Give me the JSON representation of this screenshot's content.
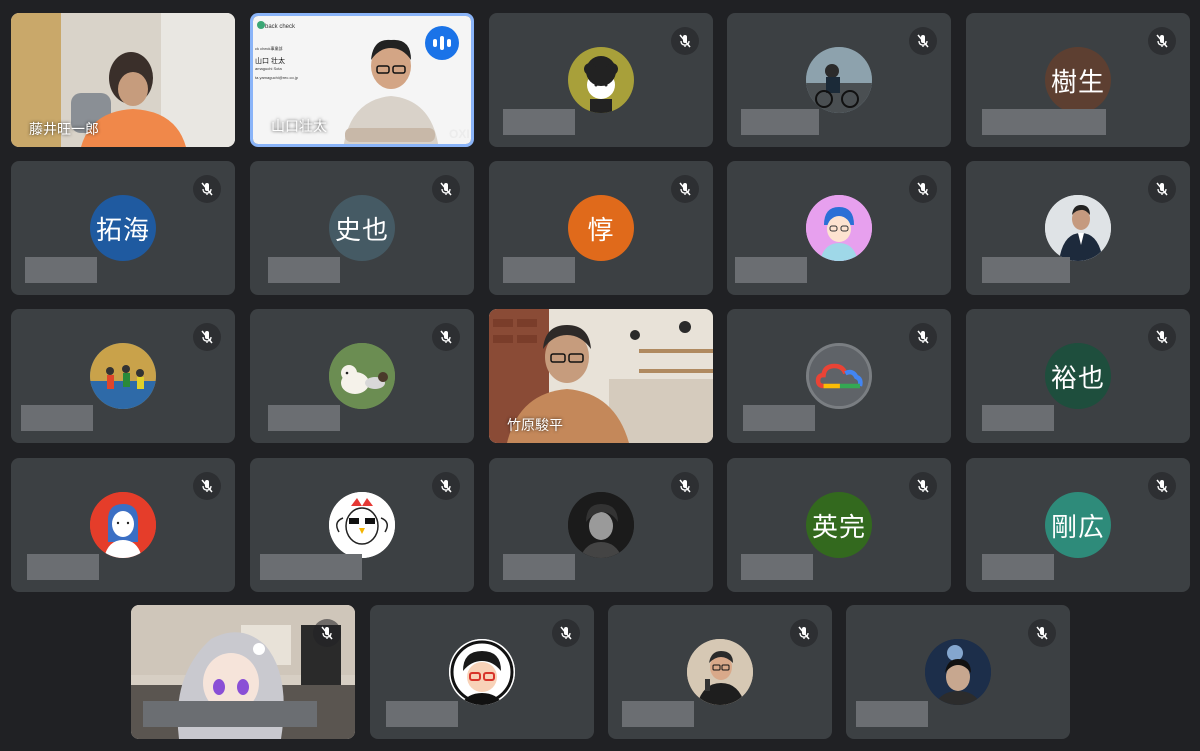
{
  "tiles": [
    {
      "id": "t1",
      "type": "video",
      "name": "藤井旺一郎"
    },
    {
      "id": "t2",
      "type": "video",
      "name": "山口壮太",
      "active": true,
      "slide": {
        "app": "back check",
        "line1": "ck check事業部",
        "line2": "山口 壮太",
        "line3": "amaguchi Sota",
        "line4": "ta.yamaguchi@rec.co.jp",
        "logo": "backcheck",
        "watermark": "OXI"
      }
    },
    {
      "id": "t3",
      "type": "avatar",
      "muted": true,
      "avatar_icon": "curly-hair-illustration-avatar",
      "avatar_color": "#a8a03a"
    },
    {
      "id": "t4",
      "type": "avatar",
      "muted": true,
      "avatar_icon": "cyclist-photo-avatar",
      "avatar_color": "#5b6e7a"
    },
    {
      "id": "t5",
      "type": "initials",
      "muted": true,
      "initials": "樹生",
      "avatar_color": "#5d3f31"
    },
    {
      "id": "t6",
      "type": "initials",
      "muted": true,
      "initials": "拓海",
      "avatar_color": "#1f5aa0"
    },
    {
      "id": "t7",
      "type": "initials",
      "muted": true,
      "initials": "史也",
      "avatar_color": "#455a64"
    },
    {
      "id": "t8",
      "type": "initials",
      "muted": true,
      "initials": "惇",
      "avatar_color": "#e06a1b"
    },
    {
      "id": "t9",
      "type": "avatar",
      "muted": true,
      "avatar_icon": "blue-hair-illustration-avatar",
      "avatar_color": "#e7a0ee"
    },
    {
      "id": "t10",
      "type": "avatar",
      "muted": true,
      "avatar_icon": "suit-man-photo-avatar",
      "avatar_color": "#d9dde0"
    },
    {
      "id": "t11",
      "type": "avatar",
      "muted": true,
      "avatar_icon": "soccer-team-photo-avatar",
      "avatar_color": "#2e6aa8"
    },
    {
      "id": "t12",
      "type": "avatar",
      "muted": true,
      "avatar_icon": "dog-on-grass-photo-avatar",
      "avatar_color": "#6b8d52"
    },
    {
      "id": "t13",
      "type": "video",
      "name": "竹原駿平"
    },
    {
      "id": "t14",
      "type": "avatar",
      "muted": true,
      "avatar_icon": "google-cloud-logo-avatar",
      "avatar_color": "#5f6368"
    },
    {
      "id": "t15",
      "type": "initials",
      "muted": true,
      "initials": "裕也",
      "avatar_color": "#1e4e3d"
    },
    {
      "id": "t16",
      "type": "avatar",
      "muted": true,
      "avatar_icon": "woman-illustration-avatar",
      "avatar_color": "#e53d2a"
    },
    {
      "id": "t17",
      "type": "avatar",
      "muted": true,
      "avatar_icon": "chicken-mascot-avatar",
      "avatar_color": "#ffffff"
    },
    {
      "id": "t18",
      "type": "avatar",
      "muted": true,
      "avatar_icon": "monochrome-man-photo-avatar",
      "avatar_color": "#222222"
    },
    {
      "id": "t19",
      "type": "initials",
      "muted": true,
      "initials": "英完",
      "avatar_color": "#33691e"
    },
    {
      "id": "t20",
      "type": "initials",
      "muted": true,
      "initials": "剛広",
      "avatar_color": "#2e8b7a"
    },
    {
      "id": "t21",
      "type": "video",
      "muted": true
    },
    {
      "id": "t22",
      "type": "avatar",
      "muted": true,
      "avatar_icon": "glasses-man-illustration-avatar",
      "avatar_color": "#ffffff"
    },
    {
      "id": "t23",
      "type": "avatar",
      "muted": true,
      "avatar_icon": "man-with-mic-photo-avatar",
      "avatar_color": "#c9b8a2"
    },
    {
      "id": "t24",
      "type": "avatar",
      "muted": true,
      "avatar_icon": "night-portrait-photo-avatar",
      "avatar_color": "#1c2e4a"
    }
  ]
}
